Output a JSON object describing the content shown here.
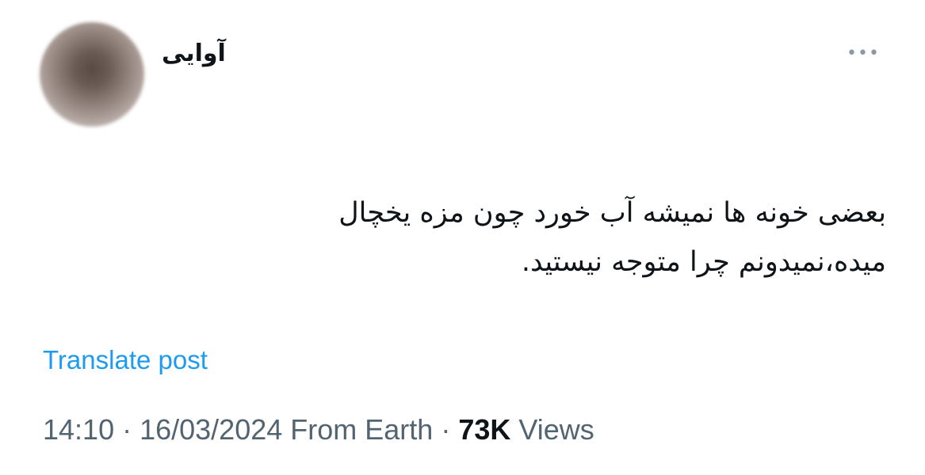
{
  "author": {
    "display_name": "آوایی"
  },
  "more_icon_glyph": "•••",
  "tweet": {
    "lines": [
      "بعضی خونه ها نمیشه آب خورد چون مزه یخچال",
      "میده،نمیدونم چرا متوجه نیستید."
    ]
  },
  "translate_label": "Translate post",
  "meta": {
    "time": "14:10",
    "sep1": " · ",
    "date": "16/03/2024",
    "source": " From Earth",
    "sep2": " · ",
    "views_count": "73K",
    "views_label": " Views"
  },
  "colors": {
    "link": "#1d9bf0",
    "text": "#0f1419",
    "muted": "#536471"
  }
}
